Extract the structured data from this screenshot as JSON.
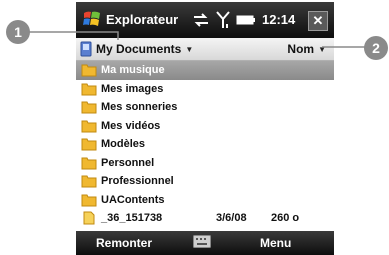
{
  "window": {
    "title": "Explorateur",
    "time": "12:14",
    "close_label": "✕"
  },
  "pathbar": {
    "folder_label": "My Documents",
    "sort_label": "Nom"
  },
  "files": [
    {
      "name": "Ma musique",
      "type": "folder",
      "selected": true
    },
    {
      "name": "Mes images",
      "type": "folder"
    },
    {
      "name": "Mes sonneries",
      "type": "folder"
    },
    {
      "name": "Mes vidéos",
      "type": "folder"
    },
    {
      "name": "Modèles",
      "type": "folder"
    },
    {
      "name": "Personnel",
      "type": "folder"
    },
    {
      "name": "Professionnel",
      "type": "folder"
    },
    {
      "name": "UAContents",
      "type": "folder"
    },
    {
      "name": "_36_151738",
      "type": "file",
      "date": "3/6/08",
      "size": "260 o"
    }
  ],
  "softkeys": {
    "left": "Remonter",
    "right": "Menu"
  },
  "callouts": [
    "1",
    "2"
  ],
  "colors": {
    "selection": "#9a9a9a",
    "titlebar": "#1a1a1a",
    "folder": "#f0b830"
  }
}
